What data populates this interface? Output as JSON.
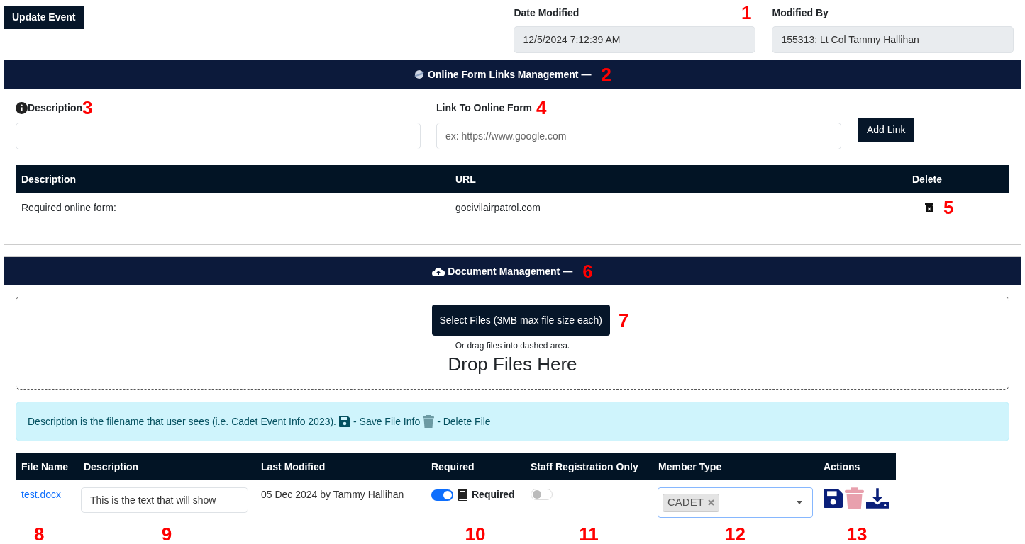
{
  "toolbar": {
    "update_button": "Update Event"
  },
  "date_modified": {
    "label": "Date Modified",
    "value": "12/5/2024 7:12:39 AM",
    "callout": "1"
  },
  "modified_by": {
    "label": "Modified By",
    "value": "155313: Lt Col Tammy Hallihan"
  },
  "links_panel": {
    "title": "Online Form Links Management",
    "collapse": "—",
    "callout": "2",
    "description_label": "Description",
    "description_callout": "3",
    "link_label": "Link To Online Form",
    "link_callout": "4",
    "link_placeholder": "ex: https://www.google.com",
    "add_button": "Add Link",
    "table": {
      "columns": [
        "Description",
        "URL",
        "Delete"
      ],
      "rows": [
        {
          "description": "Required online form:",
          "url": "gocivilairpatrol.com",
          "callout": "5"
        }
      ]
    }
  },
  "documents_panel": {
    "title": "Document Management",
    "collapse": "—",
    "callout": "6",
    "select_button": "Select Files (3MB max file size each)",
    "select_callout": "7",
    "drag_hint": "Or drag files into dashed area.",
    "drop_text": "Drop Files Here",
    "info": {
      "text": "Description is the filename that user sees (i.e. Cadet Event Info 2023).",
      "save_text": "- Save File Info",
      "delete_text": "- Delete File"
    },
    "table": {
      "columns": [
        {
          "label": "File Name",
          "callout": "8"
        },
        {
          "label": "Description",
          "callout": "9"
        },
        {
          "label": "Last Modified"
        },
        {
          "label": "Required",
          "callout": "10"
        },
        {
          "label": "Staff Registration Only",
          "callout": "11"
        },
        {
          "label": "Member Type",
          "callout": "12"
        },
        {
          "label": "Actions",
          "callout": "13"
        }
      ],
      "rows": [
        {
          "file_name": "test.docx",
          "description": "This is the text that will show",
          "last_modified": "05 Dec 2024 by Tammy Hallihan",
          "required": true,
          "required_label": "Required",
          "staff_only": false,
          "member_types": [
            "CADET"
          ]
        }
      ]
    }
  }
}
